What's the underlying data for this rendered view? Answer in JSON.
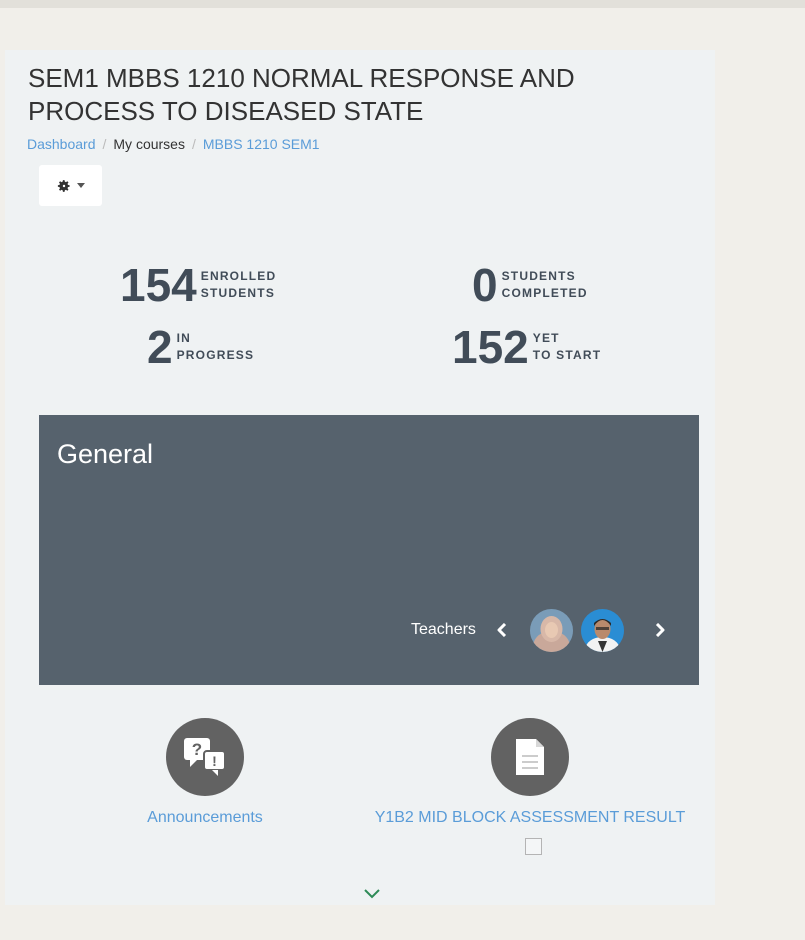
{
  "course": {
    "title": "SEM1 MBBS 1210 NORMAL RESPONSE AND PROCESS TO DISEASED STATE",
    "breadcrumb": [
      {
        "label": "Dashboard",
        "link": true
      },
      {
        "label": "My courses",
        "link": false
      },
      {
        "label": "MBBS 1210 SEM1",
        "link": true
      }
    ],
    "settings_icon": "gear-icon"
  },
  "stats": {
    "enrolled": {
      "value": "154",
      "label": "ENROLLED\nSTUDENTS"
    },
    "completed": {
      "value": "0",
      "label": "STUDENTS\nCOMPLETED"
    },
    "in_progress": {
      "value": "2",
      "label": "IN\nPROGRESS"
    },
    "yet_to_start": {
      "value": "152",
      "label": "YET\nTO START"
    }
  },
  "section": {
    "title": "General",
    "teachers_label": "Teachers",
    "background": "#56626d"
  },
  "activities": [
    {
      "label": "Announcements",
      "icon": "forum-icon"
    },
    {
      "label": "Y1B2 MID BLOCK ASSESSMENT RESULT",
      "icon": "file-icon"
    }
  ],
  "colors": {
    "link": "#5a9cd8",
    "stat_text": "#414c58",
    "icon_circle": "#626262",
    "accent_chevron": "#2e8b57"
  }
}
